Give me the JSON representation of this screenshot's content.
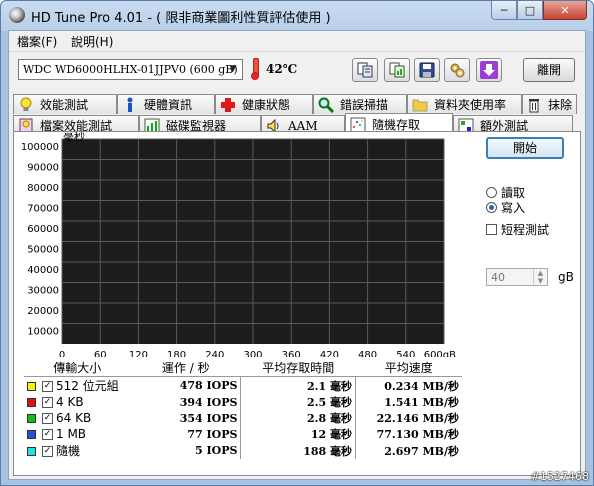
{
  "window": {
    "title": "HD Tune Pro 4.01 - ( 限非商業圖利性質評估使用 )",
    "minimize": "─",
    "maximize": "□",
    "close": "✕"
  },
  "menu": [
    {
      "label": "檔案(F)"
    },
    {
      "label": "說明(H)"
    }
  ],
  "toolbar": {
    "drive": "WDC WD6000HLHX-01JJPV0 (600 gB)",
    "temperature": "42℃",
    "exit_label": "離開",
    "icons": [
      "copy-info-icon",
      "copy-screenshot-icon",
      "save-icon",
      "options-icon",
      "download-icon"
    ]
  },
  "tabs_row1": [
    {
      "label": "效能測試",
      "icon": "bulb-icon"
    },
    {
      "label": "硬體資訊",
      "icon": "info-icon"
    },
    {
      "label": "健康狀態",
      "icon": "health-cross-icon"
    },
    {
      "label": "錯誤掃描",
      "icon": "magnifier-icon"
    },
    {
      "label": "資料夾使用率",
      "icon": "folder-icon"
    },
    {
      "label": "抹除",
      "icon": "trash-icon"
    }
  ],
  "tabs_row2": [
    {
      "label": "檔案效能測試",
      "icon": "file-benchmark-icon"
    },
    {
      "label": "磁碟監視器",
      "icon": "monitor-chart-icon"
    },
    {
      "label": "AAM",
      "icon": "speaker-icon"
    },
    {
      "label": "隨機存取",
      "icon": "random-access-icon",
      "active": true
    },
    {
      "label": "額外測試",
      "icon": "extra-tests-icon"
    }
  ],
  "controls": {
    "start_label": "開始",
    "read_label": "讀取",
    "write_label": "寫入",
    "write_selected": true,
    "short_test_label": "短程測試",
    "short_test_checked": false,
    "size_value": "40",
    "size_unit": "gB"
  },
  "chart_data": {
    "type": "scatter",
    "ylabel": "毫秒",
    "y_ticks": [
      "100000",
      "90000",
      "80000",
      "70000",
      "60000",
      "50000",
      "40000",
      "30000",
      "20000",
      "10000"
    ],
    "x_ticks": [
      "0",
      "60",
      "120",
      "180",
      "240",
      "300",
      "360",
      "420",
      "480",
      "540",
      "600gB"
    ],
    "xlim": [
      0,
      600
    ],
    "ylim": [
      0,
      100000
    ],
    "grid": true,
    "series": []
  },
  "results": {
    "headers": [
      "傳輸大小",
      "運作 / 秒",
      "平均存取時間",
      "平均速度"
    ],
    "rows": [
      {
        "color": "#f4f400",
        "size": "512 位元組",
        "ops": "478 IOPS",
        "access": "2.1 毫秒",
        "speed": "0.234 MB/秒"
      },
      {
        "color": "#e01010",
        "size": "4 KB",
        "ops": "394 IOPS",
        "access": "2.5 毫秒",
        "speed": "1.541 MB/秒"
      },
      {
        "color": "#10c010",
        "size": "64 KB",
        "ops": "354 IOPS",
        "access": "2.8 毫秒",
        "speed": "22.146 MB/秒"
      },
      {
        "color": "#2050d8",
        "size": "1 MB",
        "ops": "77 IOPS",
        "access": "12 毫秒",
        "speed": "77.130 MB/秒"
      },
      {
        "color": "#20e0e0",
        "size": "隨機",
        "ops": "5 IOPS",
        "access": "188 毫秒",
        "speed": "2.697 MB/秒"
      }
    ]
  },
  "watermark": "#1527468"
}
